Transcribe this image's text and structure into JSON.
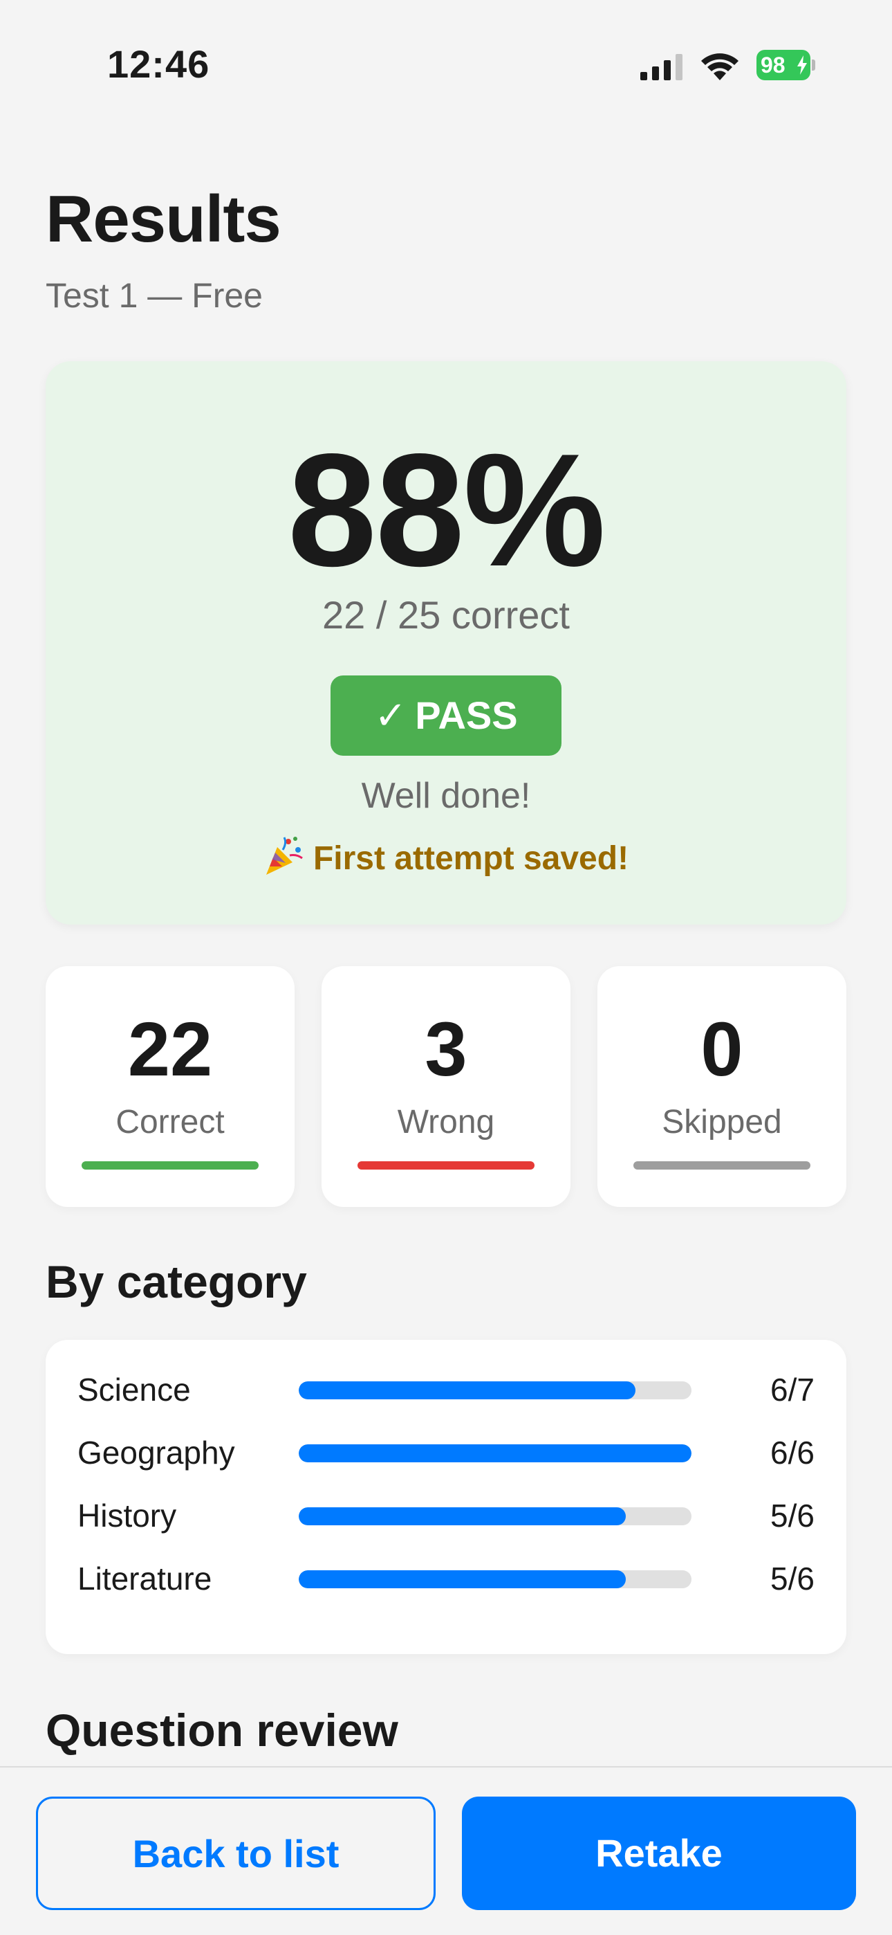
{
  "status_bar": {
    "time": "12:46",
    "battery": "98"
  },
  "header": {
    "title": "Results",
    "subtitle": "Test 1 — Free"
  },
  "score": {
    "percent": "88%",
    "correct_text": "22 / 25 correct",
    "badge_check": "✓",
    "badge_label": "PASS",
    "message": "Well done!",
    "saved_message": "First attempt saved!"
  },
  "stats": [
    {
      "value": "22",
      "label": "Correct",
      "color": "#4caf50"
    },
    {
      "value": "3",
      "label": "Wrong",
      "color": "#e53935"
    },
    {
      "value": "0",
      "label": "Skipped",
      "color": "#9e9e9e"
    }
  ],
  "category_section": {
    "title": "By category",
    "items": [
      {
        "name": "Science",
        "score": "6/7",
        "correct": 6,
        "total": 7
      },
      {
        "name": "Geography",
        "score": "6/6",
        "correct": 6,
        "total": 6
      },
      {
        "name": "History",
        "score": "5/6",
        "correct": 5,
        "total": 6
      },
      {
        "name": "Literature",
        "score": "5/6",
        "correct": 5,
        "total": 6
      }
    ]
  },
  "review_section": {
    "title": "Question review"
  },
  "actions": {
    "back_label": "Back to list",
    "retake_label": "Retake"
  },
  "colors": {
    "accent": "#007aff",
    "pass": "#4caf50",
    "card_success_bg": "#e8f5e9"
  },
  "icons": {
    "signal": "cellular-signal-icon",
    "wifi": "wifi-icon",
    "battery": "battery-charging-icon",
    "party": "party-popper-icon"
  }
}
